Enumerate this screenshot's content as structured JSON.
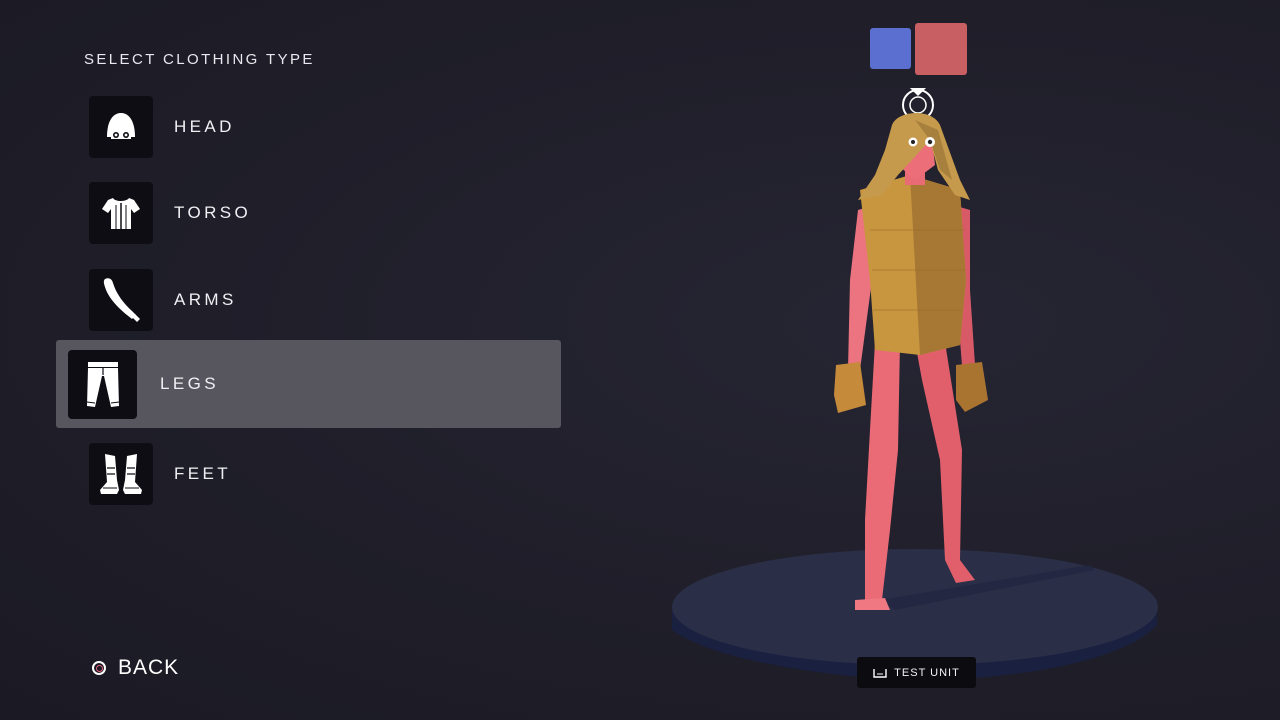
{
  "menu": {
    "title": "SELECT CLOTHING TYPE",
    "items": [
      {
        "label": "HEAD",
        "icon": "helmet-icon",
        "selected": false
      },
      {
        "label": "TORSO",
        "icon": "shirt-icon",
        "selected": false
      },
      {
        "label": "ARMS",
        "icon": "sleeve-icon",
        "selected": false
      },
      {
        "label": "LEGS",
        "icon": "pants-icon",
        "selected": true
      },
      {
        "label": "FEET",
        "icon": "boots-icon",
        "selected": false
      }
    ]
  },
  "back": {
    "label": "BACK",
    "icon": "circle-button-icon"
  },
  "team_colors": {
    "blue": "#5a6fcf",
    "red": "#c85f62"
  },
  "test_unit": {
    "label": "TEST UNIT",
    "icon": "touchpad-icon"
  },
  "colors": {
    "background": "#1f1e29",
    "tile": "#0e0d14",
    "selected_row": "#57565e",
    "skin": "#e8707a",
    "clothing": "#c89a45",
    "platform": "#2a2d45"
  }
}
